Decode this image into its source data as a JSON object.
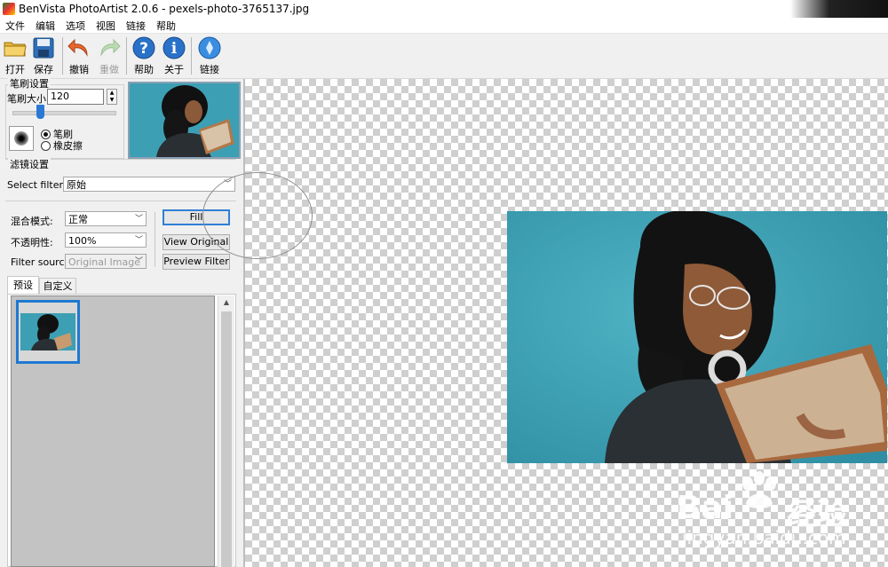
{
  "window": {
    "title": "BenVista PhotoArtist 2.0.6 - pexels-photo-3765137.jpg"
  },
  "menu": [
    "文件",
    "编辑",
    "选项",
    "视图",
    "链接",
    "帮助"
  ],
  "toolbar": {
    "open": "打开",
    "save": "保存",
    "undo": "撤销",
    "redo": "重做",
    "help": "帮助",
    "about": "关于",
    "link": "链接"
  },
  "brush": {
    "group_label": "笔刷设置",
    "size_label": "笔刷大小:",
    "size_value": "120",
    "slider_level": 0.27,
    "mode_brush": "笔刷",
    "mode_eraser": "橡皮擦"
  },
  "filter": {
    "group_label": "滤镜设置",
    "select_label": "Select filter:",
    "select_value": "原始",
    "blend_label": "混合模式:",
    "blend_value": "正常",
    "opacity_label": "不透明性:",
    "opacity_value": "100%",
    "source_label": "Filter source:",
    "source_value": "Original Image",
    "fill": "Fill",
    "view_original": "View Original",
    "preview_filter": "Preview Filter"
  },
  "tabs": [
    "预设",
    "自定义"
  ],
  "watermark": {
    "brand_a": "Bai",
    "brand_b": "经验",
    "url": "jingyan.baidu.com"
  },
  "colors": {
    "accent": "#1f78d1",
    "photo_bg": "#3fa3b6"
  }
}
